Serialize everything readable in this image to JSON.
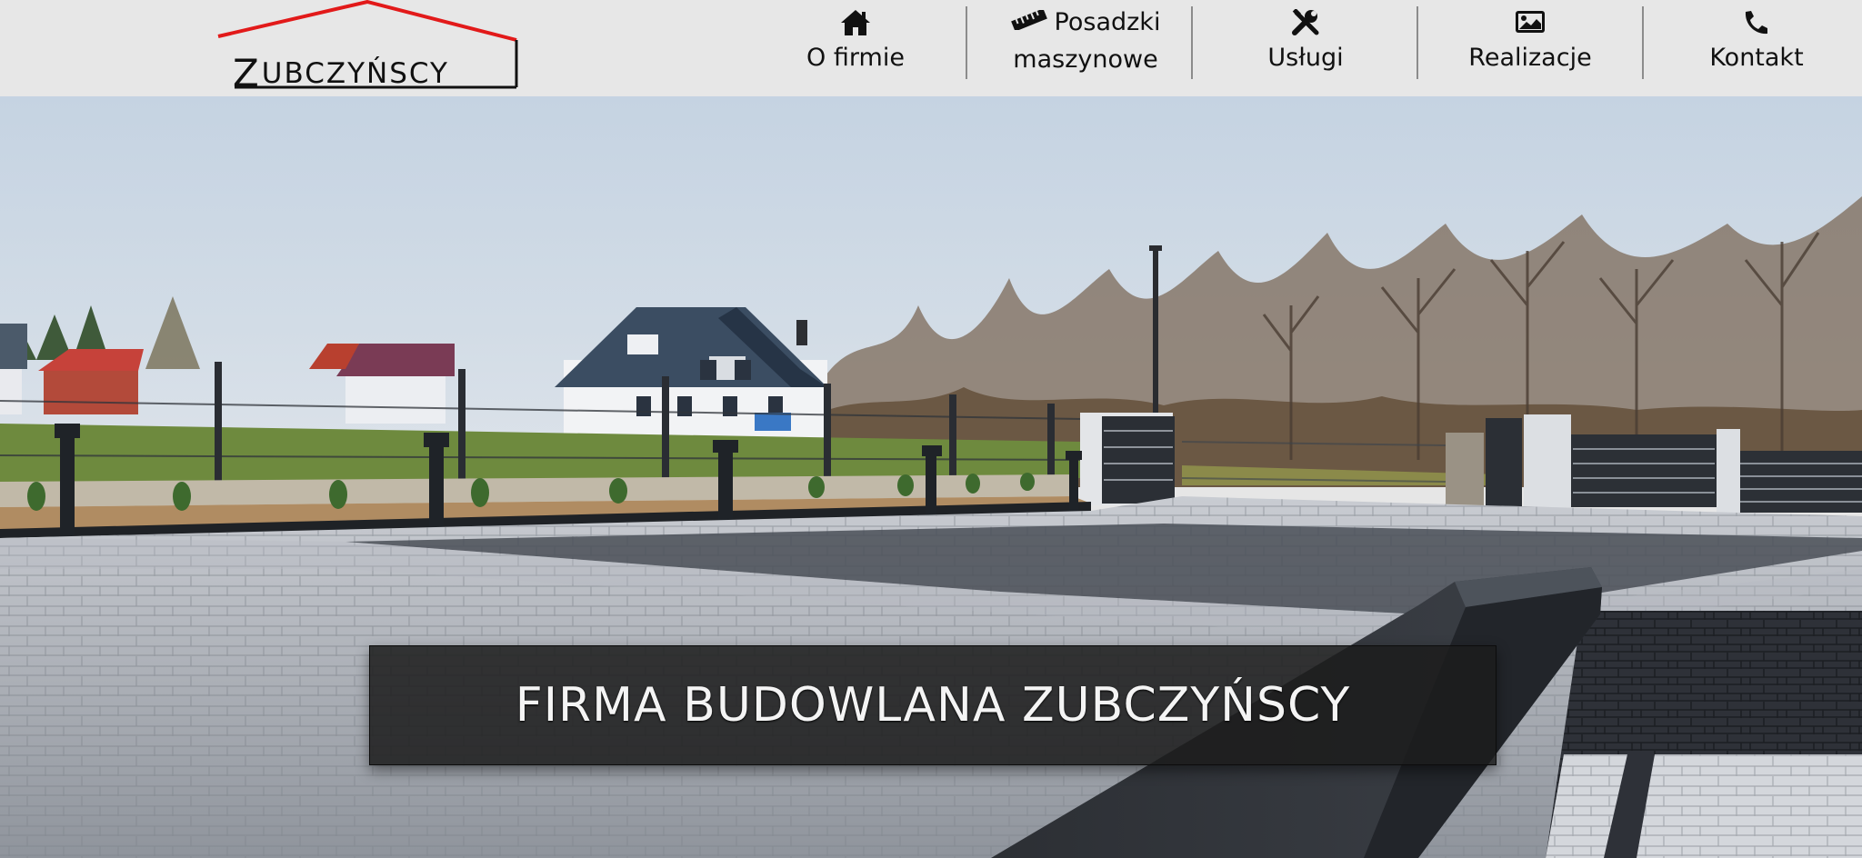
{
  "logo": {
    "text_first": "Z",
    "text_rest": "UBCZYŃSCY",
    "accent_color": "#e21a1a"
  },
  "nav": {
    "items": [
      {
        "label": "O firmie",
        "icon": "home-icon"
      },
      {
        "label_line1": "Posadzki",
        "label_line2": "maszynowe",
        "icon": "ruler-icon"
      },
      {
        "label": "Usługi",
        "icon": "tools-icon"
      },
      {
        "label": "Realizacje",
        "icon": "image-icon"
      },
      {
        "label": "Kontakt",
        "icon": "phone-icon"
      }
    ]
  },
  "hero": {
    "heading": "FIRMA BUDOWLANA ZUBCZYŃSCY",
    "image": "paved-driveway-with-gates-and-houses"
  }
}
